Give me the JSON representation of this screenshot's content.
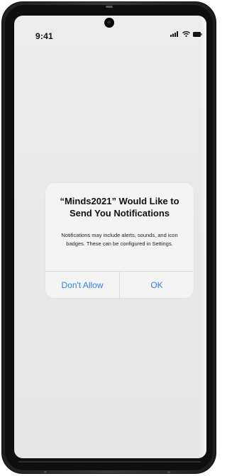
{
  "status_bar": {
    "time": "9:41",
    "icons": [
      "cellular-signal-icon",
      "wifi-icon",
      "battery-icon"
    ]
  },
  "dialog": {
    "title": "“Minds2021” Would Like to Send You Notifications",
    "message": "Notifications may include alerts, sounds, and icon badges. These can be configured in Settings.",
    "buttons": {
      "deny_label": "Don't Allow",
      "allow_label": "OK"
    }
  },
  "colors": {
    "button_text": "#2f80ed",
    "dialog_background": "#f4f4f4",
    "screen_background": "#e9e9e9",
    "frame": "#1f1f1f"
  }
}
